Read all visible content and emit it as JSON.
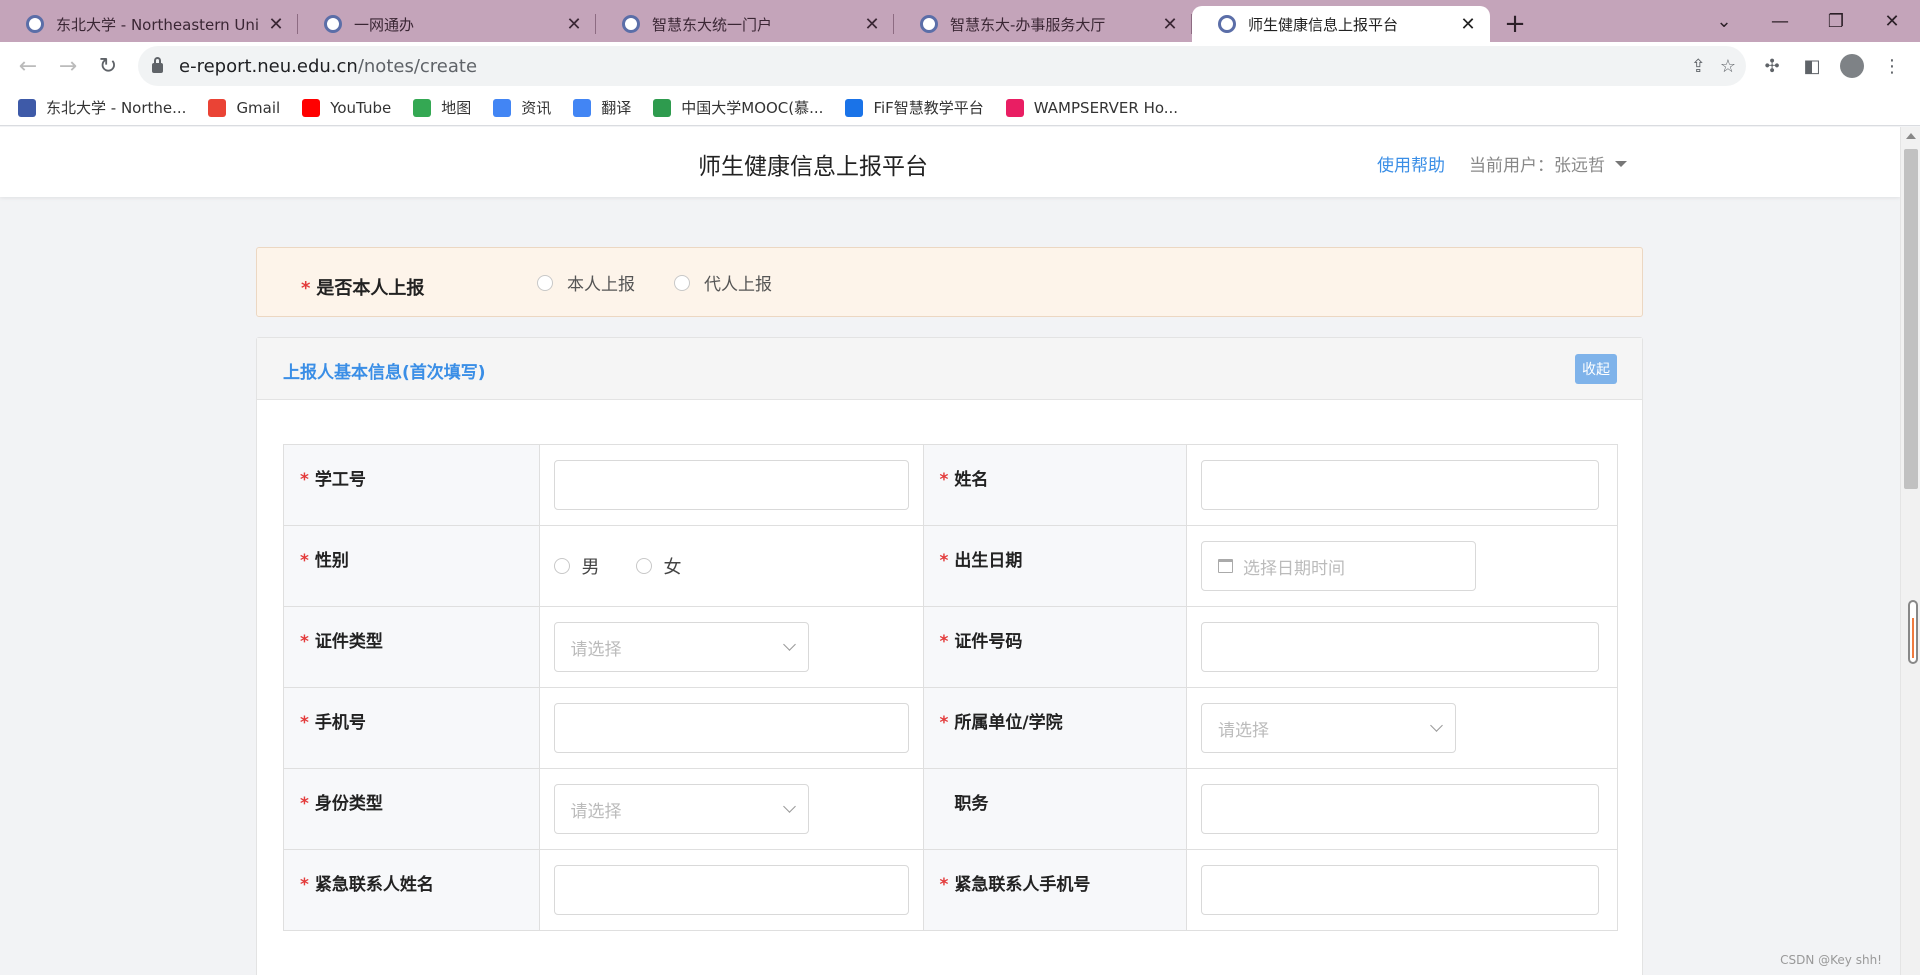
{
  "browser": {
    "tabs": [
      {
        "title": "东北大学 - Northeastern University",
        "active": false
      },
      {
        "title": "一网通办",
        "active": false
      },
      {
        "title": "智慧东大统一门户",
        "active": false
      },
      {
        "title": "智慧东大-办事服务大厅",
        "active": false
      },
      {
        "title": "师生健康信息上报平台",
        "active": true
      }
    ],
    "url_host": "e-report.neu.edu.cn",
    "url_path": "/notes/create",
    "bookmarks": [
      {
        "label": "东北大学 - Northe...",
        "icon": "neu-logo-icon",
        "color": "#3e5aa8"
      },
      {
        "label": "Gmail",
        "icon": "gmail-icon",
        "color": "#ea4335"
      },
      {
        "label": "YouTube",
        "icon": "youtube-icon",
        "color": "#ff0000"
      },
      {
        "label": "地图",
        "icon": "maps-icon",
        "color": "#34a853"
      },
      {
        "label": "资讯",
        "icon": "news-icon",
        "color": "#4285f4"
      },
      {
        "label": "翻译",
        "icon": "translate-icon",
        "color": "#4285f4"
      },
      {
        "label": "中国大学MOOC(慕...",
        "icon": "mooc-icon",
        "color": "#2e9b4e"
      },
      {
        "label": "FiF智慧教学平台",
        "icon": "fif-icon",
        "color": "#1a73e8"
      },
      {
        "label": "WAMPSERVER Ho...",
        "icon": "wamp-icon",
        "color": "#e91e63"
      }
    ]
  },
  "header": {
    "title": "师生健康信息上报平台",
    "help": "使用帮助",
    "user_label": "当前用户：张远哲"
  },
  "self_report": {
    "label": "是否本人上报",
    "options": [
      "本人上报",
      "代人上报"
    ]
  },
  "basic_info": {
    "title": "上报人基本信息(首次填写)",
    "collapse": "收起",
    "fields": {
      "student_id": "学工号",
      "name": "姓名",
      "gender": "性别",
      "gender_options": [
        "男",
        "女"
      ],
      "birth_date": "出生日期",
      "birth_placeholder": "选择日期时间",
      "id_type": "证件类型",
      "id_number": "证件号码",
      "phone": "手机号",
      "department": "所属单位/学院",
      "identity_type": "身份类型",
      "position": "职务",
      "emergency_name": "紧急联系人姓名",
      "emergency_phone": "紧急联系人手机号",
      "select_placeholder": "请选择"
    }
  },
  "watermark": "CSDN @Key shh!"
}
